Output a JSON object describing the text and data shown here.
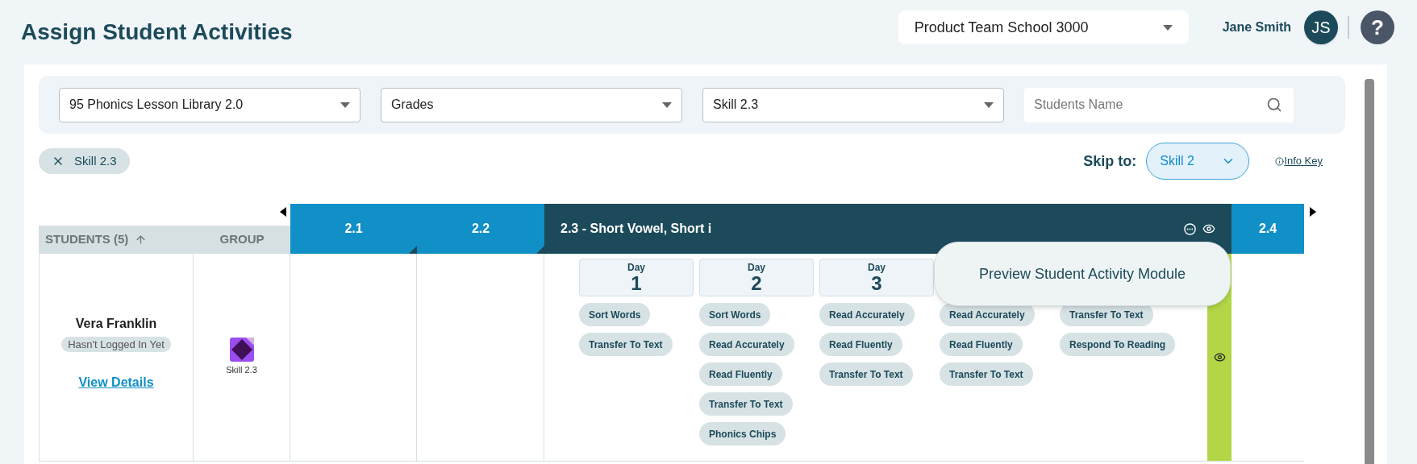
{
  "title": "Assign Student Activities",
  "school_select": {
    "value": "Product Team School 3000"
  },
  "user": {
    "name": "Jane Smith",
    "initials": "JS"
  },
  "help": "?",
  "filters": [
    {
      "kind": "select",
      "value": "95 Phonics Lesson Library 2.0"
    },
    {
      "kind": "select",
      "value": "Grades"
    },
    {
      "kind": "select",
      "value": "Skill 2.3"
    },
    {
      "kind": "search",
      "placeholder": "Students Name"
    }
  ],
  "applied_filter": "Skill 2.3",
  "skip_to": {
    "label": "Skip to:",
    "value": "Skill 2",
    "info_key": "Info Key"
  },
  "table": {
    "students_header": "STUDENTS (5)",
    "group_header": "GROUP",
    "skills": [
      {
        "label": "2.1",
        "selected": false
      },
      {
        "label": "2.2",
        "selected": false
      },
      {
        "label": "2.3 - Short Vowel, Short i",
        "selected": true
      },
      {
        "label": "2.4",
        "selected": false
      }
    ],
    "rows": [
      {
        "name": "Vera Franklin",
        "status": "Hasn't Logged In Yet",
        "link": "View Details",
        "group": "Skill 2.3",
        "days": [
          {
            "label": "Day",
            "number": "1",
            "activities": [
              "Sort Words",
              "Transfer To Text"
            ]
          },
          {
            "label": "Day",
            "number": "2",
            "activities": [
              "Sort Words",
              "Read Accurately",
              "Read Fluently",
              "Transfer To Text",
              "Phonics Chips"
            ]
          },
          {
            "label": "Day",
            "number": "3",
            "activities": [
              "Read Accurately",
              "Read Fluently",
              "Transfer To Text"
            ]
          },
          {
            "activities": [
              "Read Accurately",
              "Read Fluently",
              "Transfer To Text"
            ]
          },
          {
            "activities": [
              "Transfer To Text",
              "Respond To Reading"
            ]
          }
        ]
      }
    ]
  },
  "tooltip": "Preview Student Activity Module"
}
